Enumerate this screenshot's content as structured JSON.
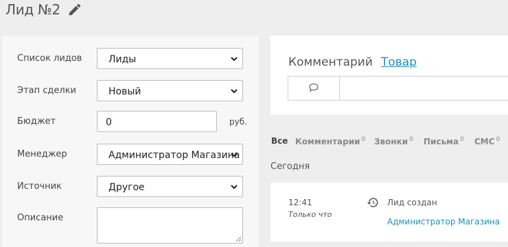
{
  "header": {
    "title": "Лид №2",
    "edit_icon": "pencil-icon"
  },
  "form": {
    "lead_list": {
      "label": "Список лидов",
      "value": "Лиды"
    },
    "deal_stage": {
      "label": "Этап сделки",
      "value": "Новый"
    },
    "budget": {
      "label": "Бюджет",
      "value": "0",
      "currency": "руб."
    },
    "manager": {
      "label": "Менеджер",
      "value": "Администратор Магазина"
    },
    "source": {
      "label": "Источник",
      "value": "Другое"
    },
    "description": {
      "label": "Описание",
      "value": ""
    }
  },
  "comment_card": {
    "tab_comment": "Комментарий",
    "tab_product": "Товар",
    "comment_icon": "speech-bubble-icon"
  },
  "filters": {
    "all": "Все",
    "comments": {
      "label": "Комментарии",
      "count": "0"
    },
    "calls": {
      "label": "Звонки",
      "count": "0"
    },
    "letters": {
      "label": "Письма",
      "count": "0"
    },
    "sms": {
      "label": "СМС",
      "count": "0"
    }
  },
  "timeline": {
    "group": "Сегодня",
    "event": {
      "time": "12:41",
      "relative": "Только что",
      "icon": "history-icon",
      "text": "Лид создан",
      "author": "Администратор Магазина"
    }
  },
  "colors": {
    "link": "#1c8fbd",
    "background": "#eeeeee",
    "panel": "#f7f7f7"
  }
}
